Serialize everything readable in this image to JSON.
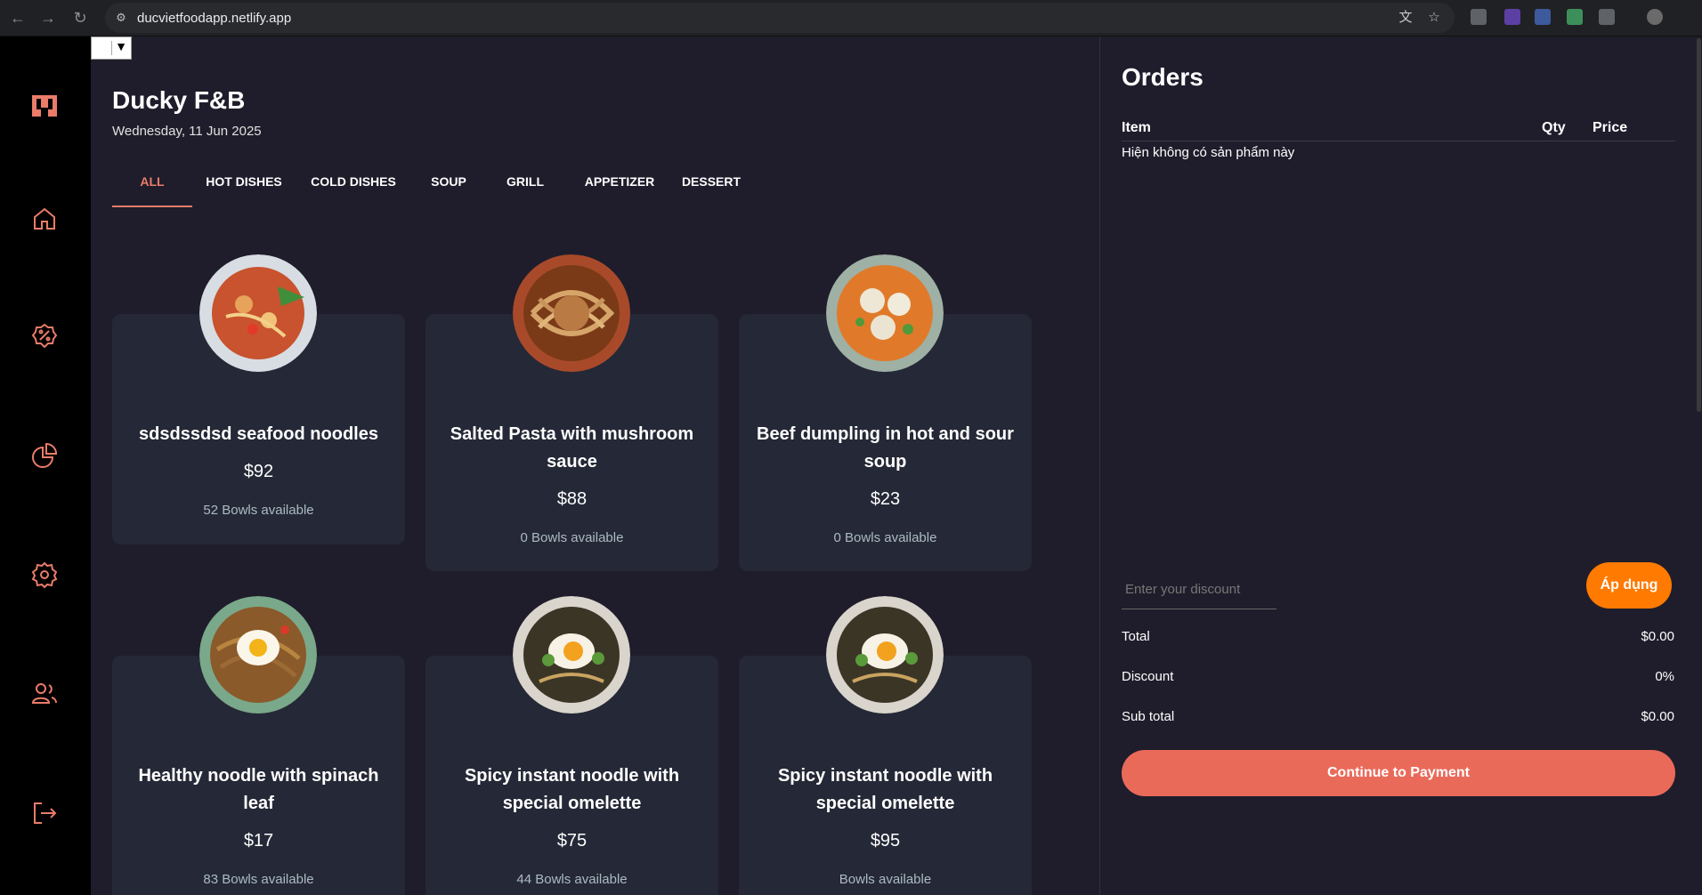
{
  "browser": {
    "url": "ducvietfoodapp.netlify.app"
  },
  "nav": {
    "items": [
      "store-icon",
      "home-icon",
      "discount-icon",
      "chart-icon",
      "settings-icon",
      "users-icon",
      "logout-icon"
    ],
    "accent": "#ea7c69"
  },
  "header": {
    "brand": "Ducky F&B",
    "date": "Wednesday, 11 Jun 2025",
    "language_select": "▼"
  },
  "tabs": [
    {
      "label": "ALL",
      "active": true
    },
    {
      "label": "HOT DISHES",
      "active": false
    },
    {
      "label": "COLD DISHES",
      "active": false
    },
    {
      "label": "SOUP",
      "active": false
    },
    {
      "label": "GRILL",
      "active": false
    },
    {
      "label": "APPETIZER",
      "active": false
    },
    {
      "label": "DESSERT",
      "active": false
    }
  ],
  "dishes": [
    {
      "name": "sdsdssdsd seafood noodles",
      "price": "$92",
      "availability": "52 Bowls available",
      "image": "seafood-noodles"
    },
    {
      "name": "Salted Pasta with mushroom sauce",
      "price": "$88",
      "availability": "0 Bowls available",
      "image": "pasta"
    },
    {
      "name": "Beef dumpling in hot and sour soup",
      "price": "$23",
      "availability": "0 Bowls available",
      "image": "dumpling-soup"
    },
    {
      "name": "Healthy noodle with spinach leaf",
      "price": "$17",
      "availability": "83 Bowls available",
      "image": "fried-noodle-egg"
    },
    {
      "name": "Spicy instant noodle with special omelette",
      "price": "$75",
      "availability": "44 Bowls available",
      "image": "ramen-egg"
    },
    {
      "name": "Spicy instant noodle with special omelette",
      "price": "$95",
      "availability": "Bowls available",
      "image": "ramen-egg"
    }
  ],
  "orders": {
    "title": "Orders",
    "columns": {
      "item": "Item",
      "qty": "Qty",
      "price": "Price"
    },
    "empty_message": "Hiện không có sản phẩm này",
    "discount_placeholder": "Enter your discount",
    "apply_label": "Áp dụng",
    "total_label": "Total",
    "total_value": "$0.00",
    "discount_label": "Discount",
    "discount_value": "0%",
    "subtotal_label": "Sub total",
    "subtotal_value": "$0.00",
    "pay_label": "Continue to Payment"
  }
}
